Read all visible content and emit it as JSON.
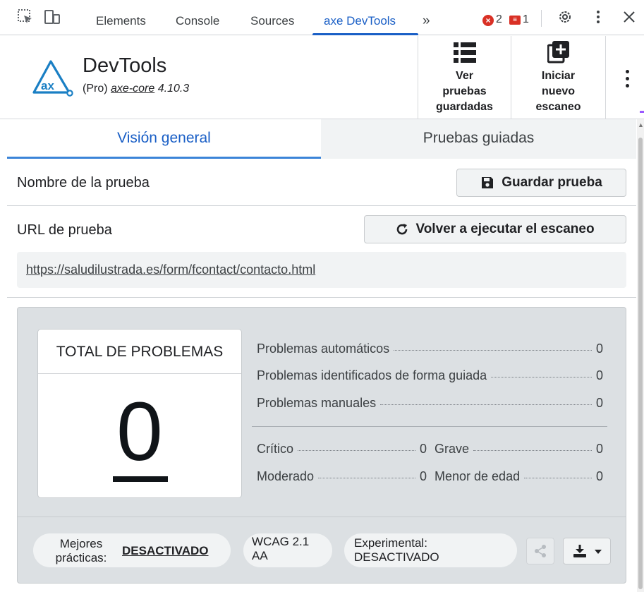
{
  "devtools": {
    "tabs": [
      "Elements",
      "Console",
      "Sources",
      "axe DevTools"
    ],
    "active_tab": "axe DevTools",
    "more_tabs": "»",
    "error_count": "2",
    "issue_count": "1",
    "accent_color": "#1a5fc6",
    "icons": [
      "inspect-element-icon",
      "device-toolbar-icon",
      "error-icon",
      "issue-flag-icon",
      "gear-icon",
      "kebab-menu-icon",
      "close-icon"
    ]
  },
  "axe": {
    "brand_title": "DevTools",
    "brand_tier": "(Pro)",
    "brand_core": "axe-core",
    "brand_version": " 4.10.3",
    "logo_text": "ax",
    "saved_tests_label": [
      "Ver",
      "pruebas",
      "guardadas"
    ],
    "new_scan_label": [
      "Iniciar",
      "nuevo",
      "escaneo"
    ]
  },
  "tabs": {
    "overview": "Visión general",
    "guided": "Pruebas guiadas"
  },
  "form": {
    "test_name_label": "Nombre de la prueba",
    "save_button": "Guardar prueba",
    "test_url_label": "URL de prueba",
    "rerun_button": "Volver a ejecutar el escaneo",
    "url": "https://saludilustrada.es/form/fcontact/contacto.html"
  },
  "summary": {
    "total_label": "TOTAL DE PROBLEMAS",
    "total_value": "0",
    "automatic": {
      "label": "Problemas automáticos",
      "value": "0"
    },
    "guided": {
      "label": "Problemas identificados de forma guiada",
      "value": "0"
    },
    "manual": {
      "label": "Problemas manuales",
      "value": "0"
    },
    "critical": {
      "label": "Crítico",
      "value": "0"
    },
    "serious": {
      "label": "Grave",
      "value": "0"
    },
    "moderate": {
      "label": "Moderado",
      "value": "0"
    },
    "minor": {
      "label": "Menor de edad",
      "value": "0"
    }
  },
  "footer": {
    "best_practices_label": [
      "Mejores",
      "prácticas:"
    ],
    "best_practices_value": "DESACTIVADO",
    "standard": [
      "WCAG 2.1",
      "AA"
    ],
    "experimental": [
      "Experimental:",
      "DESACTIVADO"
    ]
  }
}
